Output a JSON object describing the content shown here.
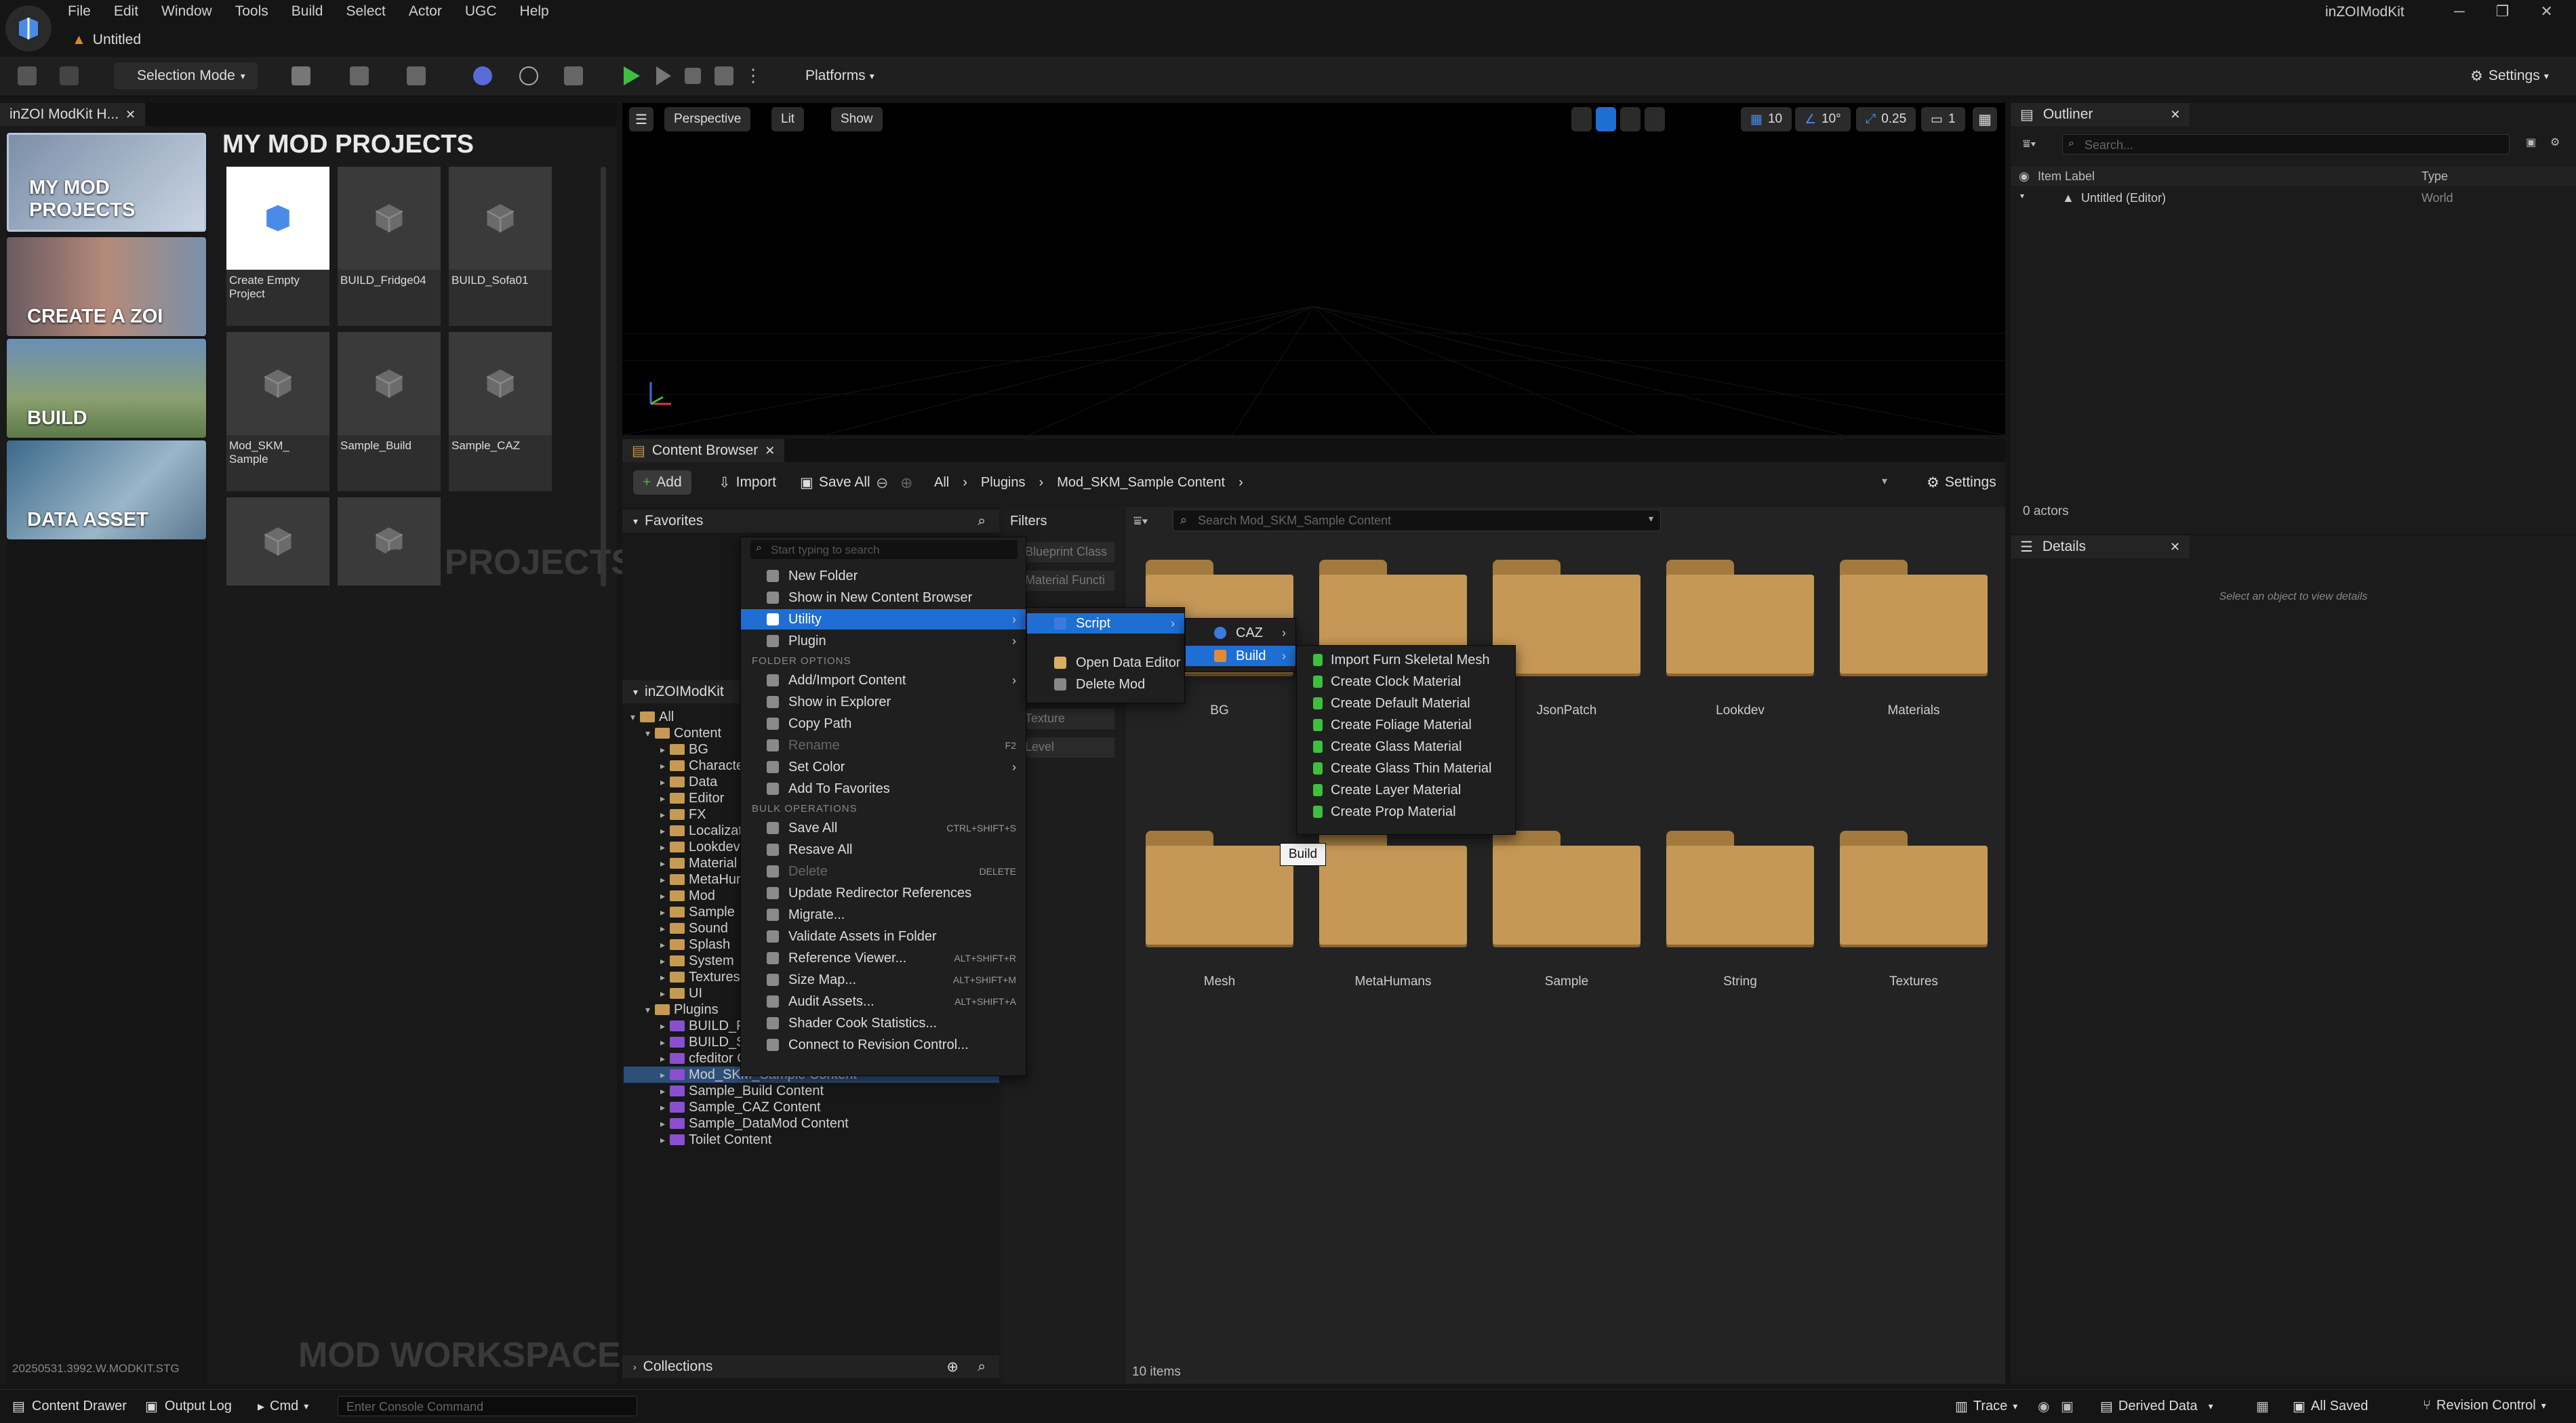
{
  "app": {
    "name": "inZOIModKit",
    "document": "Untitled"
  },
  "menubar": [
    "File",
    "Edit",
    "Window",
    "Tools",
    "Build",
    "Select",
    "Actor",
    "UGC",
    "Help"
  ],
  "toolbar": {
    "selection_mode": "Selection Mode",
    "platforms": "Platforms",
    "settings": "Settings"
  },
  "hub": {
    "tab": "inZOI ModKit H...",
    "title": "MY MOD PROJECTS",
    "sidebar": [
      "MY MOD PROJECTS",
      "CREATE A ZOI",
      "BUILD",
      "DATA ASSET"
    ],
    "projects": [
      "Create Empty Project",
      "BUILD_Fridge04",
      "BUILD_Sofa01",
      "Mod_SKM_ Sample",
      "Sample_Build",
      "Sample_CAZ"
    ],
    "watermark_top": "MOD PROJECTS",
    "watermark_bottom": "MOD WORKSPACES",
    "version": "20250531.3992.W.MODKIT.STG"
  },
  "viewport": {
    "perspective": "Perspective",
    "lit": "Lit",
    "show": "Show",
    "grid": "10",
    "angle": "10°",
    "scale": "0.25",
    "cam": "1"
  },
  "content_browser": {
    "tab": "Content Browser",
    "add": "Add",
    "import": "Import",
    "save_all": "Save All",
    "breadcrumb": [
      "All",
      "Plugins",
      "Mod_SKM_Sample Content"
    ],
    "settings": "Settings",
    "favorites": "Favorites",
    "root": "inZOIModKit",
    "filters": "Filters",
    "filter_items": [
      "Blueprint Class",
      "Material Functi",
      "Texture",
      "Level"
    ],
    "search_placeholder": "Search Mod_SKM_Sample Content",
    "collections": "Collections",
    "items": "10 items",
    "folders": [
      "BG",
      "",
      "JsonPatch",
      "Lookdev",
      "Materials",
      "Mesh",
      "MetaHumans",
      "Sample",
      "String",
      "Textures"
    ],
    "tree": [
      {
        "label": "All",
        "d": 0
      },
      {
        "label": "Content",
        "d": 1
      },
      {
        "label": "BG",
        "d": 2
      },
      {
        "label": "Characters",
        "d": 2
      },
      {
        "label": "Data",
        "d": 2
      },
      {
        "label": "Editor",
        "d": 2
      },
      {
        "label": "FX",
        "d": 2
      },
      {
        "label": "Localization",
        "d": 2
      },
      {
        "label": "Lookdev",
        "d": 2
      },
      {
        "label": "Material",
        "d": 2
      },
      {
        "label": "MetaHumans",
        "d": 2
      },
      {
        "label": "Mod",
        "d": 2
      },
      {
        "label": "Sample",
        "d": 2
      },
      {
        "label": "Sound",
        "d": 2
      },
      {
        "label": "Splash",
        "d": 2
      },
      {
        "label": "System",
        "d": 2
      },
      {
        "label": "Textures",
        "d": 2
      },
      {
        "label": "UI",
        "d": 2
      },
      {
        "label": "Plugins",
        "d": 1
      },
      {
        "label": "BUILD_Fridge04 Content",
        "d": 2,
        "p": 1
      },
      {
        "label": "BUILD_Sofa01 Content",
        "d": 2,
        "p": 1
      },
      {
        "label": "cfeditor Content",
        "d": 2,
        "p": 1
      },
      {
        "label": "Mod_SKM_Sample Content",
        "d": 2,
        "p": 1,
        "sel": 1
      },
      {
        "label": "Sample_Build Content",
        "d": 2,
        "p": 1
      },
      {
        "label": "Sample_CAZ Content",
        "d": 2,
        "p": 1
      },
      {
        "label": "Sample_DataMod Content",
        "d": 2,
        "p": 1
      },
      {
        "label": "Toilet Content",
        "d": 2,
        "p": 1
      }
    ]
  },
  "context_menu": {
    "search_placeholder": "Start typing to search",
    "top": [
      "New Folder",
      "Show in New Content Browser",
      "Utility",
      "Plugin"
    ],
    "folder_options_header": "FOLDER OPTIONS",
    "folder": [
      "Add/Import Content",
      "Show in Explorer",
      "Copy Path",
      "Rename",
      "Set Color",
      "Add To Favorites"
    ],
    "bulk_header": "BULK OPERATIONS",
    "bulk": [
      {
        "l": "Save All",
        "s": "CTRL+SHIFT+S"
      },
      {
        "l": "Resave All",
        "s": ""
      },
      {
        "l": "Delete",
        "s": "DELETE"
      },
      {
        "l": "Update Redirector References",
        "s": ""
      },
      {
        "l": "Migrate...",
        "s": ""
      },
      {
        "l": "Validate Assets in Folder",
        "s": ""
      },
      {
        "l": "Reference Viewer...",
        "s": "ALT+SHIFT+R"
      },
      {
        "l": "Size Map...",
        "s": "ALT+SHIFT+M"
      },
      {
        "l": "Audit Assets...",
        "s": "ALT+SHIFT+A"
      },
      {
        "l": "Shader Cook Statistics...",
        "s": ""
      },
      {
        "l": "Connect to Revision Control...",
        "s": ""
      }
    ],
    "rename_shortcut": "F2"
  },
  "utility_menu": [
    "Script",
    "Open Data Editor",
    "Delete Mod"
  ],
  "script_menu": [
    "CAZ",
    "Build"
  ],
  "build_menu": [
    "Import Furn Skeletal Mesh",
    "Create Clock Material",
    "Create Default Material",
    "Create Foliage Material",
    "Create Glass Material",
    "Create Glass Thin Material",
    "Create Layer Material",
    "Create Prop Material"
  ],
  "tooltip": "Build",
  "outliner": {
    "tab": "Outliner",
    "search_placeholder": "Search...",
    "col_label": "Item Label",
    "col_type": "Type",
    "row_label": "Untitled (Editor)",
    "row_type": "World",
    "actors": "0 actors"
  },
  "details": {
    "tab": "Details",
    "empty": "Select an object to view details"
  },
  "statusbar": {
    "content_drawer": "Content Drawer",
    "output_log": "Output Log",
    "cmd": "Cmd",
    "console_placeholder": "Enter Console Command",
    "trace": "Trace",
    "derived": "Derived Data",
    "saved": "All Saved",
    "revision": "Revision Control"
  },
  "colors": {
    "accent": "#1f6ed4",
    "folder": "#c59857",
    "play": "#3fbf3f"
  }
}
